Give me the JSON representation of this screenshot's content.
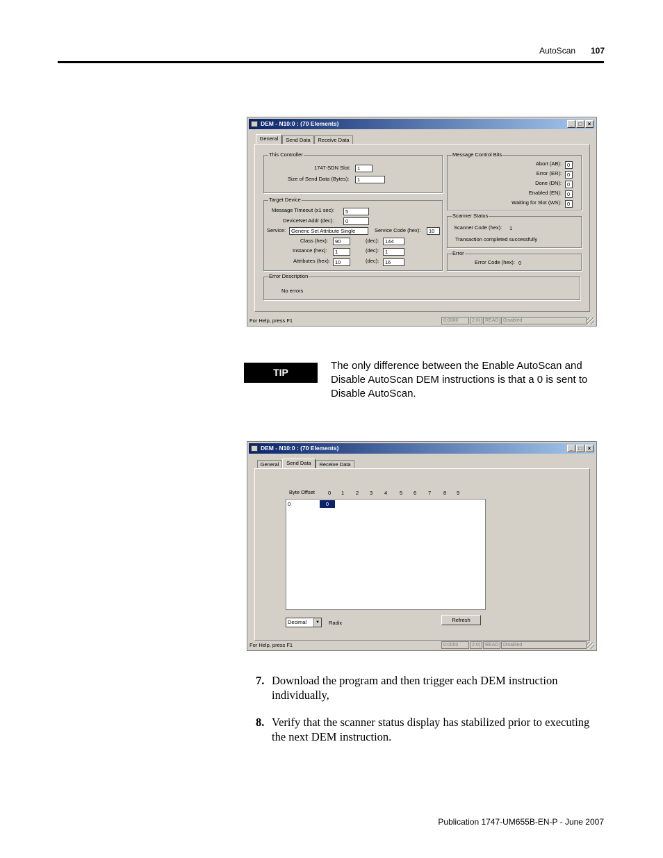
{
  "header": {
    "section": "AutoScan",
    "page": "107"
  },
  "footer": {
    "publication": "Publication 1747-UM655B-EN-P - June 2007"
  },
  "window_title": "DEM - N10:0 : (70 Elements)",
  "window_buttons": {
    "min": "_",
    "max": "□",
    "close": "×"
  },
  "tabs": [
    "General",
    "Send Data",
    "Receive Data"
  ],
  "status_bar": {
    "help": "For Help, press F1",
    "addr": "0:0000",
    "pos": "2:0(",
    "mode": "READ",
    "state": "Disabled"
  },
  "general": {
    "this_controller": {
      "label": "This Controller",
      "slot_label": "1747-SDN Slot:",
      "slot_value": "1",
      "size_label": "Size of Send Data (Bytes):",
      "size_value": "1"
    },
    "target_device": {
      "label": "Target Device",
      "timeout_label": "Message Timeout (x1 sec):",
      "timeout_value": "5",
      "addr_label": "DeviceNet Addr (dec):",
      "addr_value": "0",
      "service_label": "Service:",
      "service_value": "Generic Set Attribute Single",
      "service_code_label": "Service Code (hex):",
      "service_code_value": "10",
      "class_label": "Class (hex):",
      "class_hex": "90",
      "class_dec_label": "(dec):",
      "class_dec": "144",
      "instance_label": "Instance (hex):",
      "instance_hex": "1",
      "instance_dec_label": "(dec):",
      "instance_dec": "1",
      "attribute_label": "Attributes (hex):",
      "attribute_hex": "10",
      "attribute_dec_label": "(dec):",
      "attribute_dec": "16"
    },
    "message_control_bits": {
      "label": "Message Control Bits",
      "items": [
        {
          "label": "Abort (AB):",
          "value": "0"
        },
        {
          "label": "Error (ER):",
          "value": "0"
        },
        {
          "label": "Done (DN):",
          "value": "0"
        },
        {
          "label": "Enabled (EN):",
          "value": "0"
        },
        {
          "label": "Waiting for Slot (WS):",
          "value": "0"
        }
      ]
    },
    "scanner_status": {
      "label": "Scanner Status",
      "code_label": "Scanner Code (hex):",
      "code_value": "1",
      "message": "Transaction completed successfully"
    },
    "error": {
      "label": "Error",
      "code_label": "Error Code (hex):",
      "code_value": "0"
    },
    "error_description": {
      "label": "Error Description",
      "text": "No errors"
    }
  },
  "send_data": {
    "byte_offset_label": "Byte Offset",
    "columns": [
      "0",
      "1",
      "2",
      "3",
      "4",
      "5",
      "6",
      "7",
      "8",
      "9"
    ],
    "row_offset": "0",
    "cell_value": "0",
    "radix_value": "Decimal",
    "radix_label": "Radix",
    "refresh_label": "Refresh"
  },
  "tip": {
    "label": "TIP",
    "text": "The only difference between the Enable AutoScan and Disable AutoScan DEM instructions is that a 0 is sent to Disable AutoScan."
  },
  "steps": [
    {
      "num": "7.",
      "text": "Download the program and then trigger each DEM instruction individually,"
    },
    {
      "num": "8.",
      "text": "Verify that the scanner status display has stabilized prior to executing the next DEM instruction."
    }
  ]
}
